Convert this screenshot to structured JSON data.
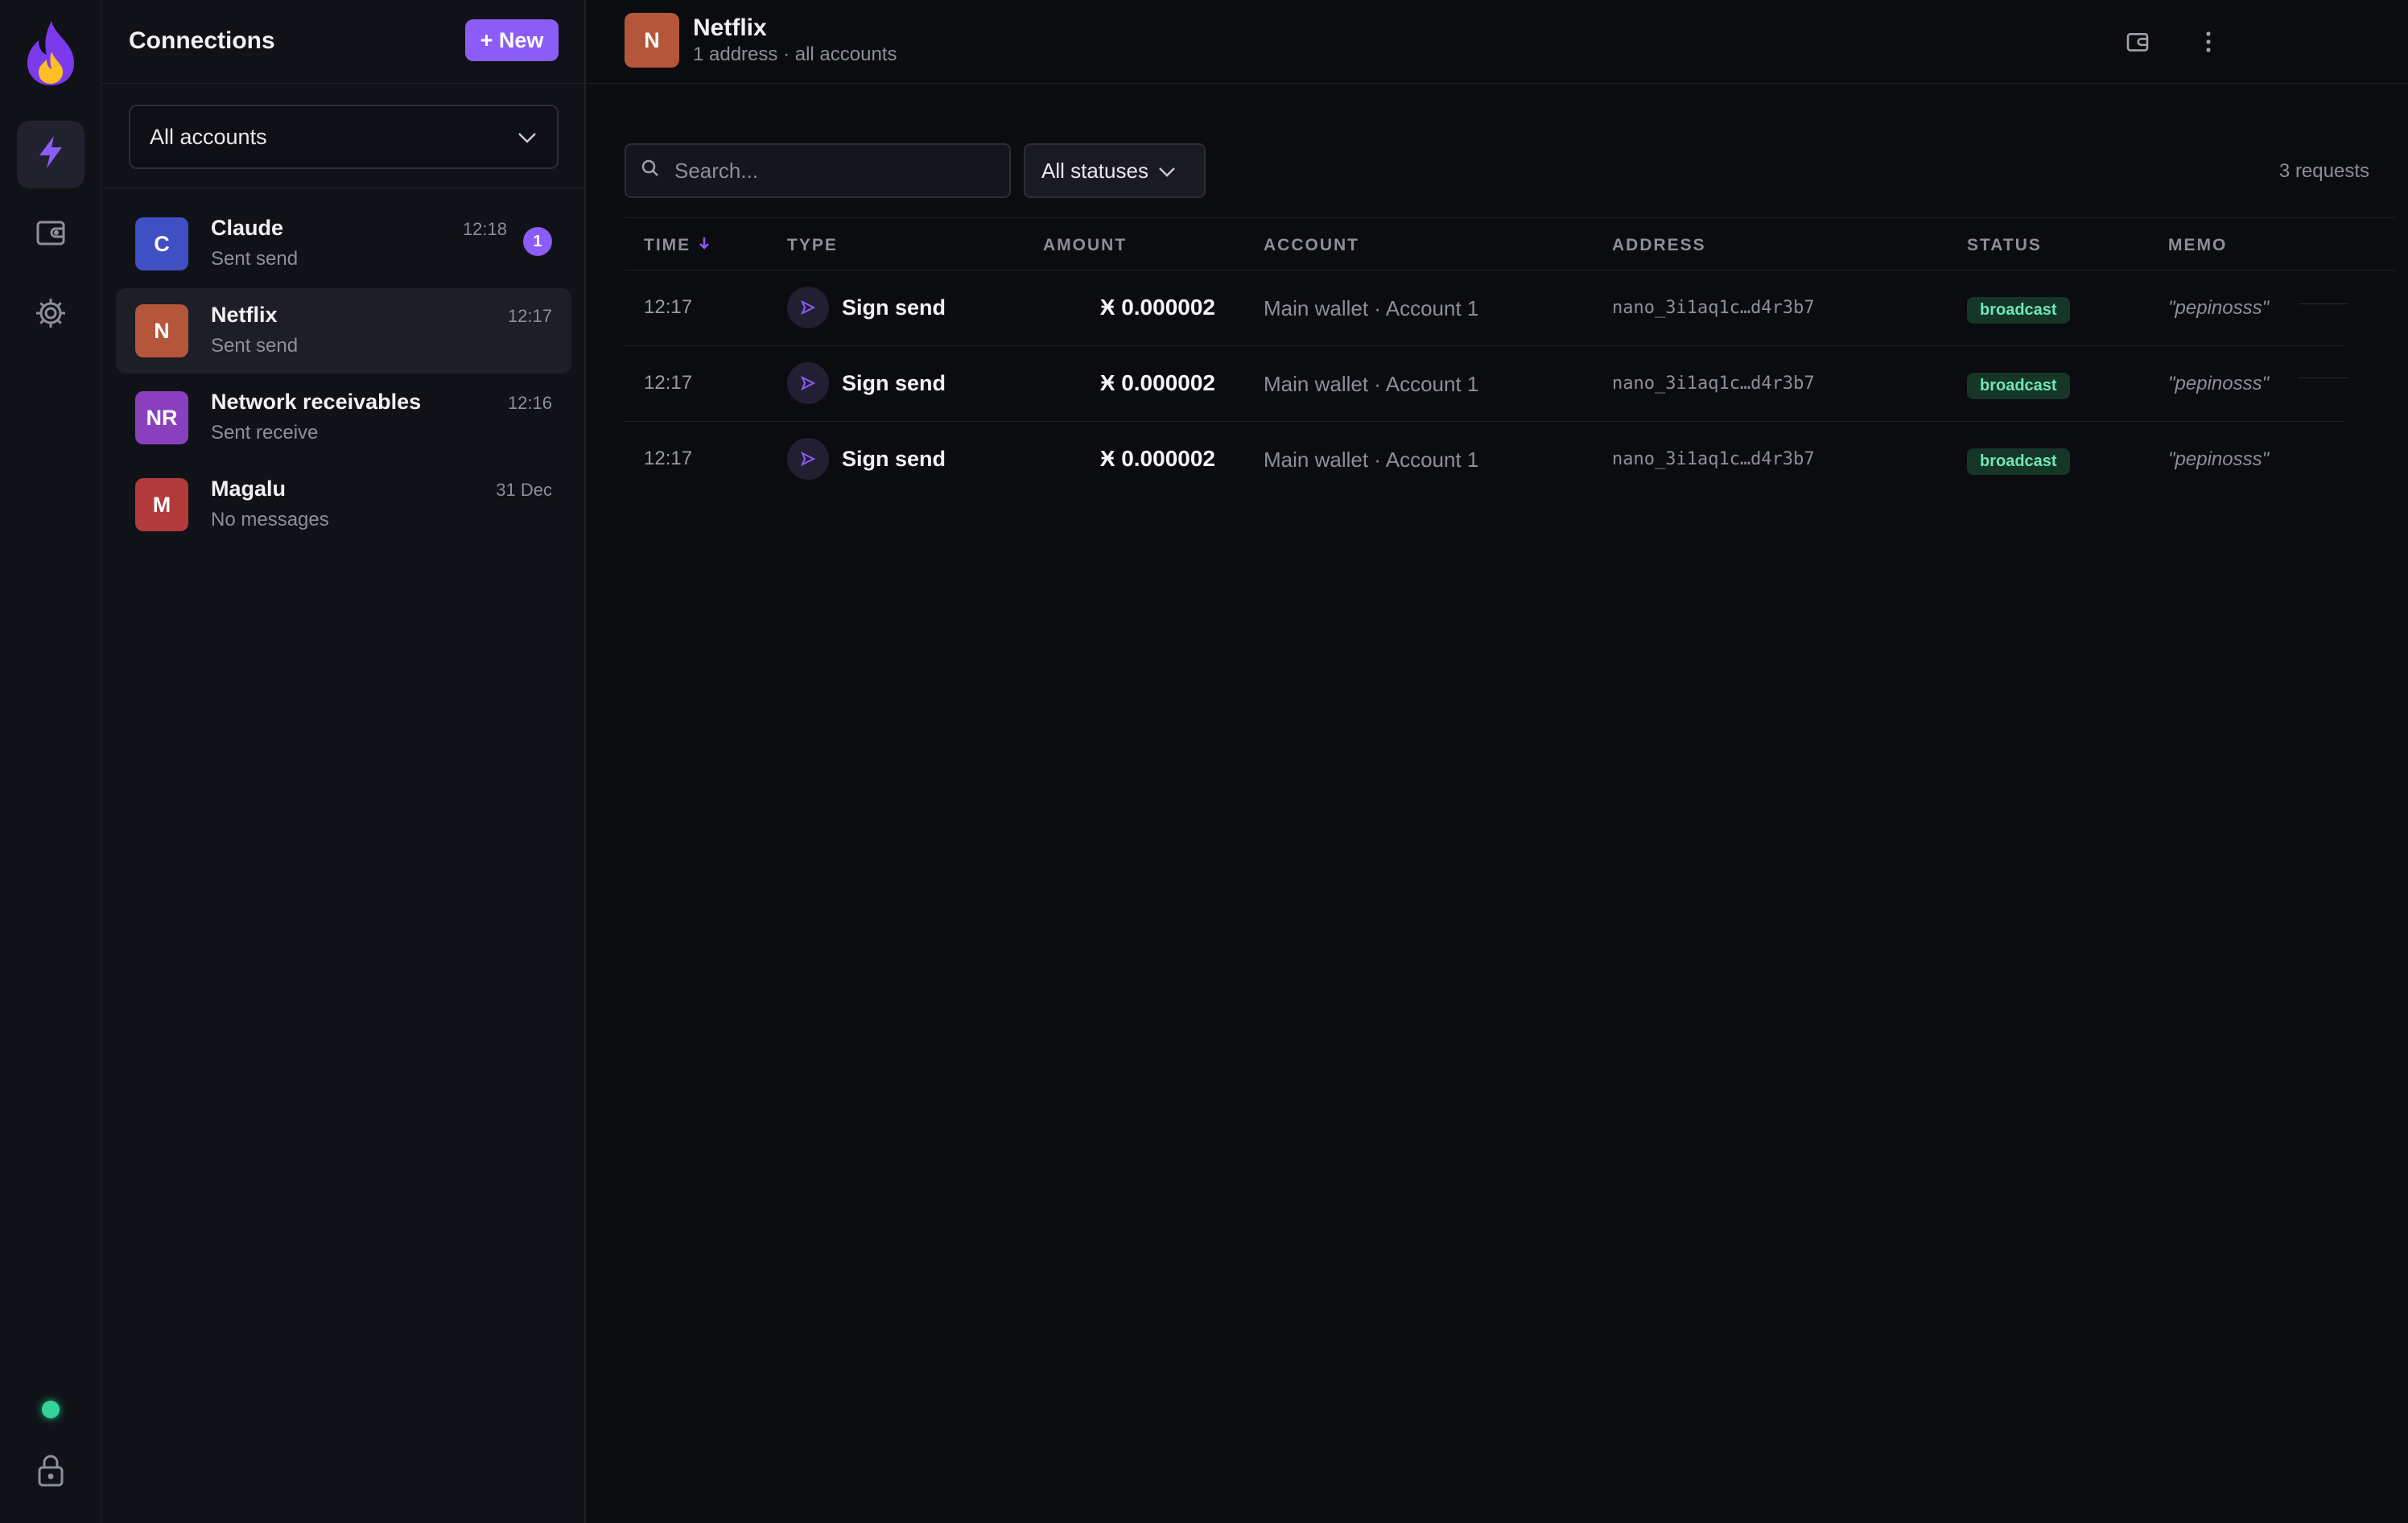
{
  "sidebar": {
    "title": "Connections",
    "new_label": "+ New"
  },
  "account_filter": {
    "selected": "All accounts"
  },
  "conversations": [
    {
      "initials": "C",
      "name": "Claude",
      "subtitle": "Sent send",
      "time": "12:18",
      "badge": "1",
      "color": "#3f4fc4"
    },
    {
      "initials": "N",
      "name": "Netflix",
      "subtitle": "Sent send",
      "time": "12:17",
      "color": "#b5563b"
    },
    {
      "initials": "NR",
      "name": "Network receivables",
      "subtitle": "Sent receive",
      "time": "12:16",
      "color": "#8a3fbf"
    },
    {
      "initials": "M",
      "name": "Magalu",
      "subtitle": "No messages",
      "time": "31 Dec",
      "color": "#b23a3a"
    }
  ],
  "main": {
    "initials": "N",
    "title": "Netflix",
    "subtitle": "1 address · all accounts",
    "search_placeholder": "Search...",
    "status_filter": "All statuses",
    "request_count": "3 requests"
  },
  "table": {
    "columns": {
      "time": "TIME",
      "type": "TYPE",
      "amount": "AMOUNT",
      "account": "ACCOUNT",
      "address": "ADDRESS",
      "status": "STATUS",
      "memo": "MEMO"
    },
    "rows": [
      {
        "time": "12:17",
        "type": "Sign send",
        "amount": "Ӿ 0.000002",
        "account": "Main wallet · Account 1",
        "address": "nano_3i1aq1c…d4r3b7",
        "status": "broadcast",
        "memo": "\"pepinosss\""
      },
      {
        "time": "12:17",
        "type": "Sign send",
        "amount": "Ӿ 0.000002",
        "account": "Main wallet · Account 1",
        "address": "nano_3i1aq1c…d4r3b7",
        "status": "broadcast",
        "memo": "\"pepinosss\""
      },
      {
        "time": "12:17",
        "type": "Sign send",
        "amount": "Ӿ 0.000002",
        "account": "Main wallet · Account 1",
        "address": "nano_3i1aq1c…d4r3b7",
        "status": "broadcast",
        "memo": "\"pepinosss\""
      }
    ]
  },
  "colors": {
    "accent": "#8b5cf6",
    "online": "#34d399",
    "status_bg": "#153528",
    "status_fg": "#6ee7b7"
  },
  "icons": {
    "rail": [
      "flame-logo-icon",
      "lightning-icon",
      "wallet-icon",
      "gear-icon",
      "lock-icon"
    ],
    "header": [
      "wallet-icon",
      "more-vertical-icon"
    ]
  }
}
